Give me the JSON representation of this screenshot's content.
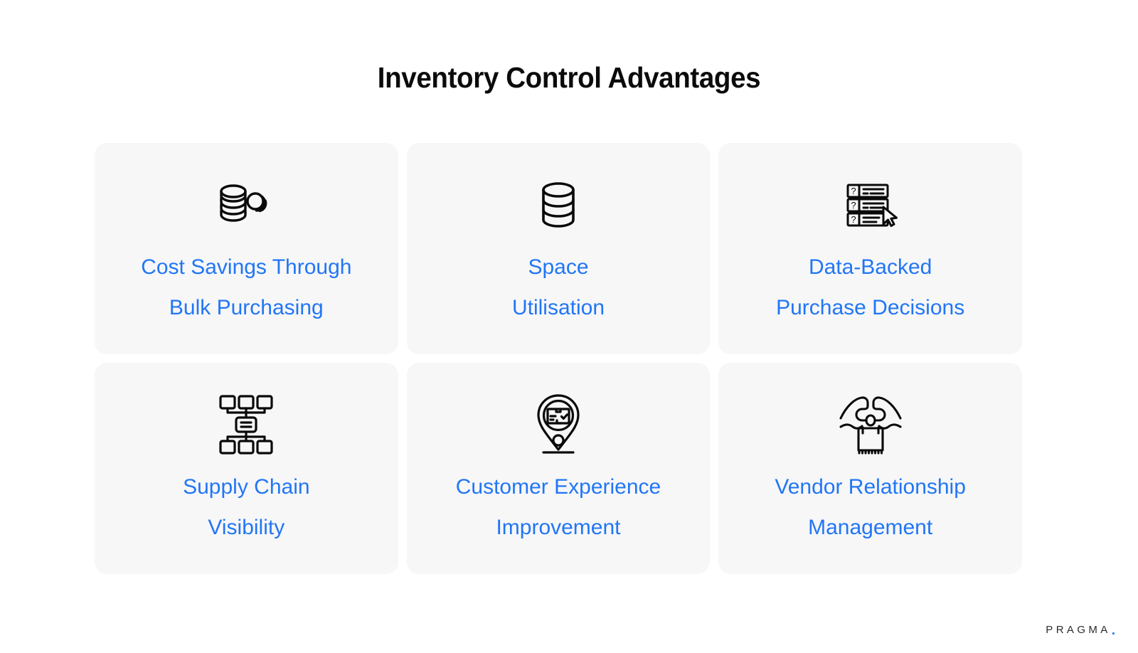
{
  "page": {
    "title": "Inventory Control Advantages",
    "background_color": "#ffffff",
    "accent_color": "#2176f5",
    "card_background_color": "#f7f7f8",
    "title_color": "#0b0b0b"
  },
  "cards": [
    {
      "icon": "stacked-coins-icon",
      "title_line1": "Cost Savings Through",
      "title_line2": "Bulk Purchasing"
    },
    {
      "icon": "database-cylinder-icon",
      "title_line1": "Space",
      "title_line2": "Utilisation"
    },
    {
      "icon": "question-list-cursor-icon",
      "title_line1": "Data-Backed",
      "title_line2": "Purchase Decisions"
    },
    {
      "icon": "network-hierarchy-icon",
      "title_line1": "Supply Chain",
      "title_line2": "Visibility"
    },
    {
      "icon": "map-pin-package-icon",
      "title_line1": "Customer Experience",
      "title_line2": "Improvement"
    },
    {
      "icon": "handshake-package-icon",
      "title_line1": "Vendor Relationship",
      "title_line2": "Management"
    }
  ],
  "brand": {
    "name": "PRAGMA",
    "dot": "."
  }
}
